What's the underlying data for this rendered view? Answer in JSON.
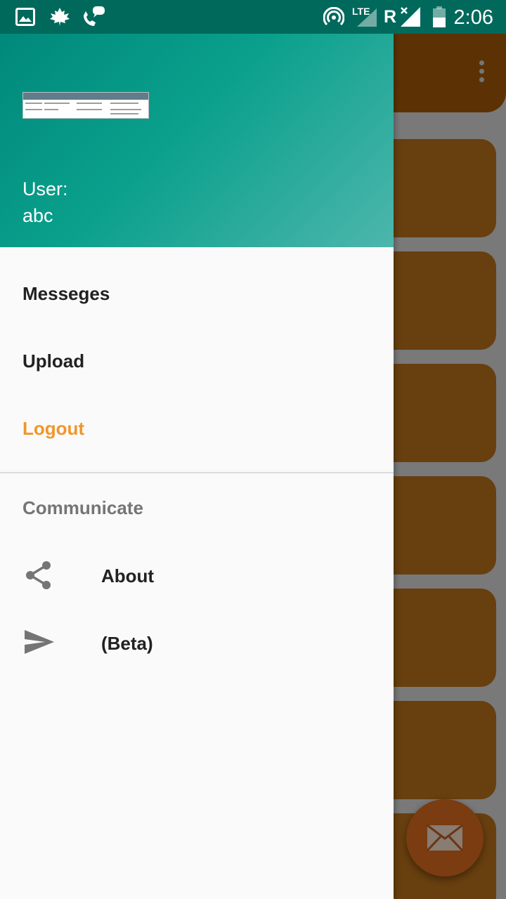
{
  "status_bar": {
    "time": "2:06",
    "network_label": "LTE",
    "roaming_label": "R",
    "icons": [
      "image-icon",
      "maple-leaf-icon",
      "phone-chat-icon",
      "hotspot-icon",
      "lte-signal-icon",
      "no-signal-icon",
      "battery-icon"
    ]
  },
  "drawer": {
    "header": {
      "user_label": "User:",
      "user_name": "abc"
    },
    "menu": [
      {
        "label": "Messeges"
      },
      {
        "label": "Upload"
      },
      {
        "label": "Logout"
      }
    ],
    "section": {
      "title": "Communicate",
      "items": [
        {
          "label": "About",
          "icon": "share-icon"
        },
        {
          "label": "(Beta)",
          "icon": "send-icon"
        }
      ]
    }
  },
  "colors": {
    "primary_dark": "#00695c",
    "header_gradient_start": "#00897b",
    "header_gradient_end": "#4db6ac",
    "logout_accent": "#f0962a",
    "background_app_accent": "#c87a1e"
  }
}
